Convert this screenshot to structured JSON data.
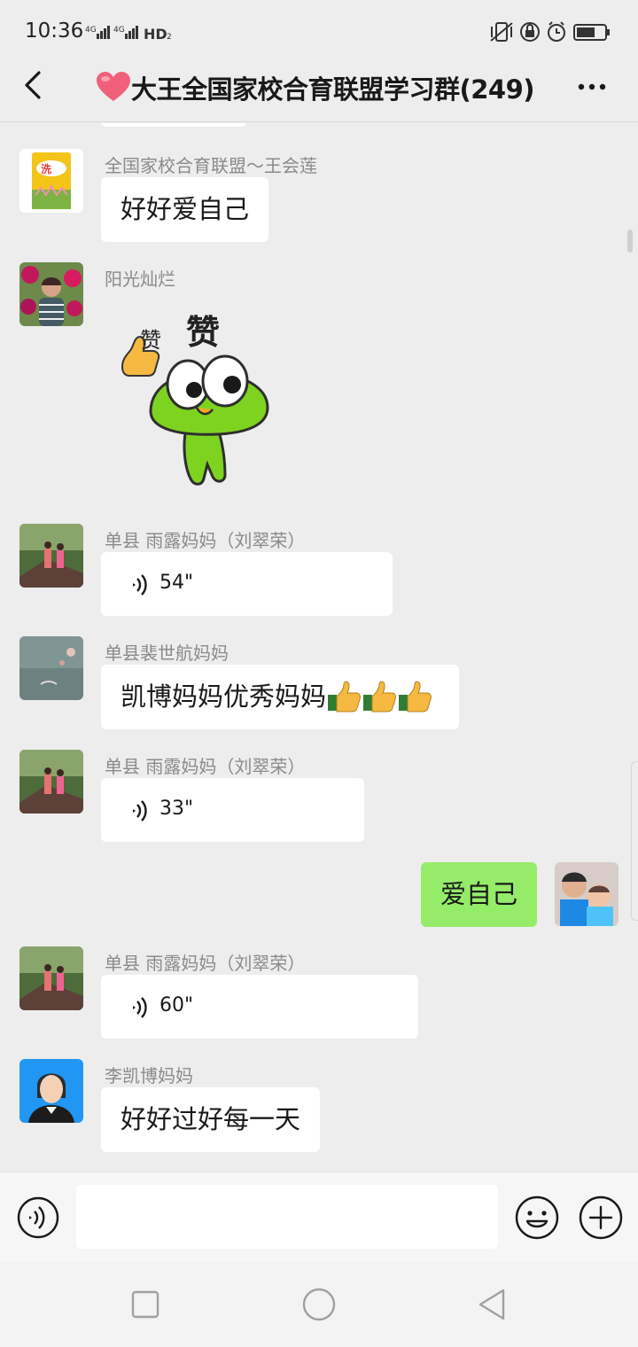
{
  "status_bar": {
    "time": "10:36",
    "network": "4G 4G HD2",
    "icons": [
      "vibrate-icon",
      "lock-rotation-icon",
      "alarm-icon",
      "battery-icon"
    ]
  },
  "header": {
    "title": "大王全国家校合育联盟学习群(249)",
    "back_icon": "chevron-left-icon",
    "heart_icon": "heart-icon",
    "more_icon": "more-icon"
  },
  "messages": [
    {
      "sender": "全国家校合育联盟～王会莲",
      "type": "text",
      "text": "好好爱自己"
    },
    {
      "sender": "阳光灿烂",
      "type": "sticker",
      "sticker_text": "赞",
      "sticker_text2": "赞"
    },
    {
      "sender": "单县 雨露妈妈（刘翠荣）",
      "type": "voice",
      "duration": "54\""
    },
    {
      "sender": "单县裴世航妈妈",
      "type": "text",
      "text": "凯博妈妈优秀妈妈",
      "emoji": "thumbs-up-icon"
    },
    {
      "sender": "单县 雨露妈妈（刘翠荣）",
      "type": "voice",
      "duration": "33\""
    },
    {
      "sender": "me",
      "type": "text",
      "text": "爱自己",
      "outgoing": true
    },
    {
      "sender": "单县 雨露妈妈（刘翠荣）",
      "type": "voice",
      "duration": "60\""
    },
    {
      "sender": "李凯博妈妈",
      "type": "text",
      "text": "好好过好每一天"
    }
  ],
  "input_bar": {
    "placeholder": "",
    "voice_icon": "voice-mode-icon",
    "emoji_icon": "emoji-icon",
    "plus_icon": "plus-icon"
  },
  "nav_bar": {
    "icons": [
      "recent-apps-icon",
      "home-icon",
      "back-icon"
    ]
  },
  "colors": {
    "background": "#ededed",
    "bubble_incoming": "#ffffff",
    "bubble_outgoing": "#95ec69",
    "sender_text": "#8a8a8a"
  }
}
